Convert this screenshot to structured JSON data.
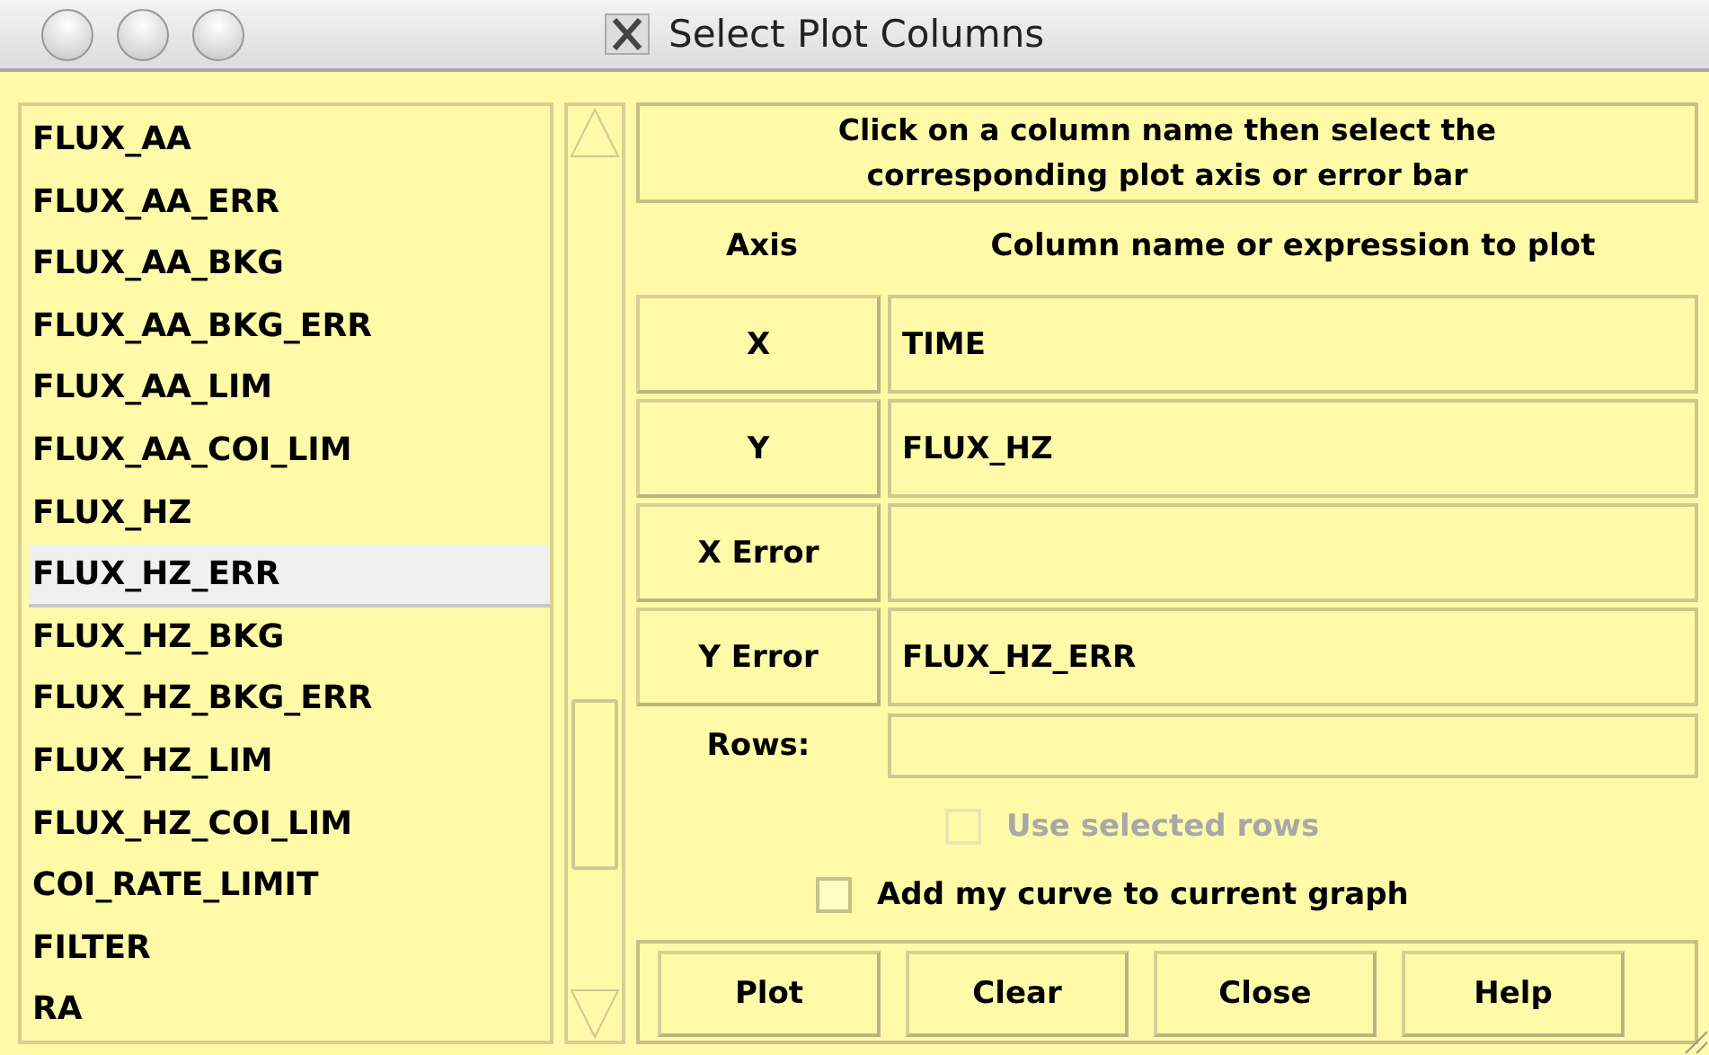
{
  "window": {
    "title": "Select Plot Columns"
  },
  "columns": [
    {
      "label": "FLUX_AA",
      "selected": false
    },
    {
      "label": "FLUX_AA_ERR",
      "selected": false
    },
    {
      "label": "FLUX_AA_BKG",
      "selected": false
    },
    {
      "label": "FLUX_AA_BKG_ERR",
      "selected": false
    },
    {
      "label": "FLUX_AA_LIM",
      "selected": false
    },
    {
      "label": "FLUX_AA_COI_LIM",
      "selected": false
    },
    {
      "label": "FLUX_HZ",
      "selected": false
    },
    {
      "label": "FLUX_HZ_ERR",
      "selected": true
    },
    {
      "label": "FLUX_HZ_BKG",
      "selected": false
    },
    {
      "label": "FLUX_HZ_BKG_ERR",
      "selected": false
    },
    {
      "label": "FLUX_HZ_LIM",
      "selected": false
    },
    {
      "label": "FLUX_HZ_COI_LIM",
      "selected": false
    },
    {
      "label": "COI_RATE_LIMIT",
      "selected": false
    },
    {
      "label": "FILTER",
      "selected": false
    },
    {
      "label": "RA",
      "selected": false
    }
  ],
  "instructions": "Click on a column name then select the corresponding plot axis or error bar",
  "headings": {
    "axis": "Axis",
    "expression": "Column name or expression to plot"
  },
  "axes": [
    {
      "axis": "X",
      "value": "TIME"
    },
    {
      "axis": "Y",
      "value": "FLUX_HZ"
    },
    {
      "axis": "X Error"
    },
    {
      "axis": "Y Error",
      "value": "FLUX_HZ_ERR"
    }
  ],
  "rows": {
    "label": "Rows:"
  },
  "options": [
    {
      "label": "Use selected rows",
      "checked": false,
      "disabled": true
    },
    {
      "label": "Add my curve to current graph",
      "checked": false,
      "disabled": false
    }
  ],
  "buttons": [
    "Plot",
    "Clear",
    "Close",
    "Help"
  ]
}
